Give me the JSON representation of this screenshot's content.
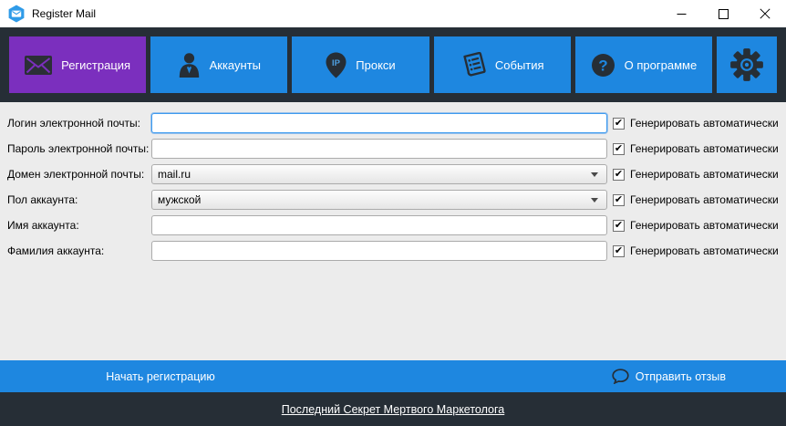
{
  "window": {
    "title": "Register Mail"
  },
  "toolbar": {
    "tabs": [
      {
        "label": "Регистрация",
        "icon": "envelope-icon",
        "active": true
      },
      {
        "label": "Аккаунты",
        "icon": "person-icon",
        "active": false
      },
      {
        "label": "Прокси",
        "icon": "ip-pin-icon",
        "active": false
      },
      {
        "label": "События",
        "icon": "events-list-icon",
        "active": false
      },
      {
        "label": "О программе",
        "icon": "question-icon",
        "active": false
      }
    ],
    "settings_icon": "gear-icon"
  },
  "form": {
    "checkbox_label": "Генерировать автоматически",
    "rows": [
      {
        "label": "Логин электронной почты:",
        "type": "text",
        "value": "",
        "checked": true,
        "focused": true
      },
      {
        "label": "Пароль электронной почты:",
        "type": "text",
        "value": "",
        "checked": true
      },
      {
        "label": "Домен электронной почты:",
        "type": "select",
        "value": "mail.ru",
        "checked": true
      },
      {
        "label": "Пол аккаунта:",
        "type": "select",
        "value": "мужской",
        "checked": true
      },
      {
        "label": "Имя аккаунта:",
        "type": "text",
        "value": "",
        "checked": true
      },
      {
        "label": "Фамилия аккаунта:",
        "type": "text",
        "value": "",
        "checked": true
      }
    ]
  },
  "action_bar": {
    "start_label": "Начать регистрацию",
    "feedback_label": "Отправить отзыв"
  },
  "footer": {
    "link_label": "Последний Секрет Мертвого Маркетолога"
  },
  "colors": {
    "accent_purple": "#7B2FBE",
    "accent_blue": "#1E87E0",
    "dark": "#262E36",
    "form_bg": "#ECECEC"
  }
}
